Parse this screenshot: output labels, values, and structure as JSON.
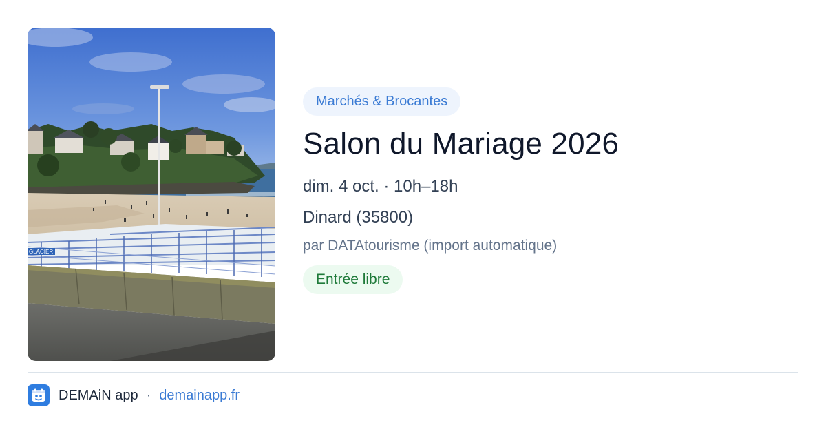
{
  "event": {
    "category": "Marchés & Brocantes",
    "title": "Salon du Mariage 2026",
    "when": "dim. 4 oct. · 10h–18h",
    "where": "Dinard (35800)",
    "source": "par DATAtourisme (import automatique)",
    "price": "Entrée libre"
  },
  "photo": {
    "sign_text": "GLACIER"
  },
  "footer": {
    "brand": "DEMAiN app",
    "separator": "·",
    "domain": "demainapp.fr",
    "logo_icon": "demain-app-logo-icon"
  },
  "colors": {
    "category_bg": "#eef4fd",
    "category_text": "#3b7bd4",
    "price_bg": "#ecfaf0",
    "price_text": "#1f7a3a",
    "title": "#0f172a",
    "link": "#3b7bd4",
    "logo_bg": "#2f7de0"
  }
}
